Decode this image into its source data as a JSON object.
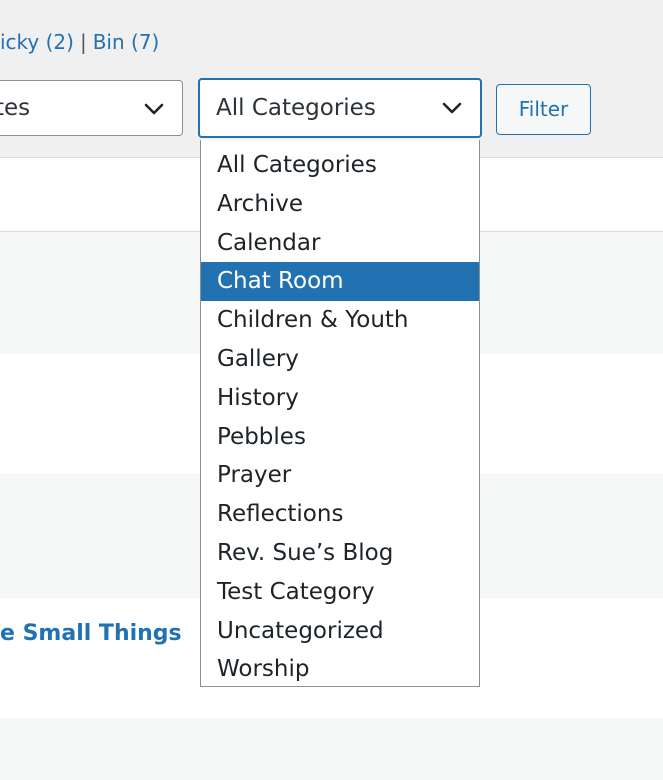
{
  "status_links": {
    "sticky": "icky (2)",
    "separator": "|",
    "bin": "Bin (7)"
  },
  "dates_select": {
    "value": "tes",
    "icon": "chevron-down-icon"
  },
  "category_select": {
    "value": "All Categories",
    "icon": "chevron-down-icon",
    "options": [
      "All Categories",
      "Archive",
      "Calendar",
      "Chat Room",
      "Children & Youth",
      "Gallery",
      "History",
      "Pebbles",
      "Prayer",
      "Reflections",
      "Rev. Sue’s Blog",
      "Test Category",
      "Uncategorized",
      "Worship"
    ],
    "highlighted": "Chat Room"
  },
  "filter_button": {
    "label": "Filter"
  },
  "posts": {
    "visible_title": "e Small Things"
  },
  "colors": {
    "accent": "#2271b1",
    "page_bg": "#f0f0f1",
    "row_bg": "#ffffff",
    "row_alt_bg": "#f6f7f7"
  }
}
